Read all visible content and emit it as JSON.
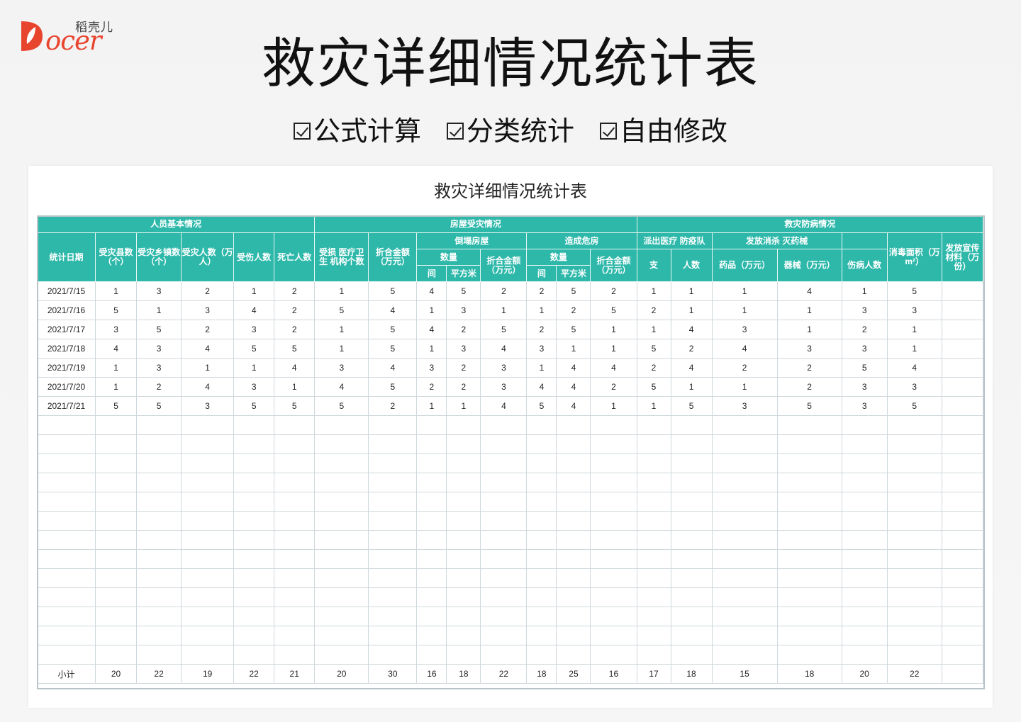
{
  "brand": {
    "cn": "稻壳儿",
    "word": "ocer",
    "accent": "#e8452f"
  },
  "title": "救灾详细情况统计表",
  "features": [
    "公式计算",
    "分类统计",
    "自由修改"
  ],
  "sheet": {
    "title": "救灾详细情况统计表",
    "header_color": "#2eb8aa",
    "groups": {
      "people": "人员基本情况",
      "house": "房屋受灾情况",
      "aid": "救灾防病情况"
    },
    "cols": {
      "date": "统计日期",
      "county": "受灾县数（个）",
      "town": "受灾乡镇数（个）",
      "pop": "受灾人数（万人）",
      "injured": "受伤人数",
      "dead": "死亡人数",
      "facility": "受损 医疗卫生 机构个数",
      "amount1": "折合金额（万元）",
      "collapse": "倒塌房屋",
      "danger": "造成危房",
      "qty": "数量",
      "qty2": "数量",
      "amount2": "折合金额（万元）",
      "amount3": "折合金额（万元）",
      "jian": "间",
      "m2": "平方米",
      "jian2": "间",
      "m2b": "平方米",
      "team": "派出医疗 防疫队",
      "zhi": "支",
      "renshu": "人数",
      "disinfect": "发放消杀 灭药械",
      "drug": "药品（万元）",
      "equip": "器械（万元）",
      "sick": "伤病人数",
      "area": "消毒面积（万 m²）",
      "promo": "发放宣传材料（万份）"
    },
    "rows": [
      [
        "2021/7/15",
        "1",
        "3",
        "2",
        "1",
        "2",
        "1",
        "5",
        "4",
        "5",
        "2",
        "2",
        "5",
        "2",
        "1",
        "1",
        "1",
        "4",
        "1",
        "5",
        ""
      ],
      [
        "2021/7/16",
        "5",
        "1",
        "3",
        "4",
        "2",
        "5",
        "4",
        "1",
        "3",
        "1",
        "1",
        "2",
        "5",
        "2",
        "1",
        "1",
        "1",
        "3",
        "3",
        ""
      ],
      [
        "2021/7/17",
        "3",
        "5",
        "2",
        "3",
        "2",
        "1",
        "5",
        "4",
        "2",
        "5",
        "2",
        "5",
        "1",
        "1",
        "4",
        "3",
        "1",
        "2",
        "1",
        ""
      ],
      [
        "2021/7/18",
        "4",
        "3",
        "4",
        "5",
        "5",
        "1",
        "5",
        "1",
        "3",
        "4",
        "3",
        "1",
        "1",
        "5",
        "2",
        "4",
        "3",
        "3",
        "1",
        ""
      ],
      [
        "2021/7/19",
        "1",
        "3",
        "1",
        "1",
        "4",
        "3",
        "4",
        "3",
        "2",
        "3",
        "1",
        "4",
        "4",
        "2",
        "4",
        "2",
        "2",
        "5",
        "4",
        ""
      ],
      [
        "2021/7/20",
        "1",
        "2",
        "4",
        "3",
        "1",
        "4",
        "5",
        "2",
        "2",
        "3",
        "4",
        "4",
        "2",
        "5",
        "1",
        "1",
        "2",
        "3",
        "3",
        ""
      ],
      [
        "2021/7/21",
        "5",
        "5",
        "3",
        "5",
        "5",
        "5",
        "2",
        "1",
        "1",
        "4",
        "5",
        "4",
        "1",
        "1",
        "5",
        "3",
        "5",
        "3",
        "5",
        ""
      ]
    ],
    "empty_rows": 13,
    "subtotal": [
      "小计",
      "20",
      "22",
      "19",
      "22",
      "21",
      "20",
      "30",
      "16",
      "18",
      "22",
      "18",
      "25",
      "16",
      "17",
      "18",
      "15",
      "18",
      "20",
      "22",
      ""
    ]
  }
}
